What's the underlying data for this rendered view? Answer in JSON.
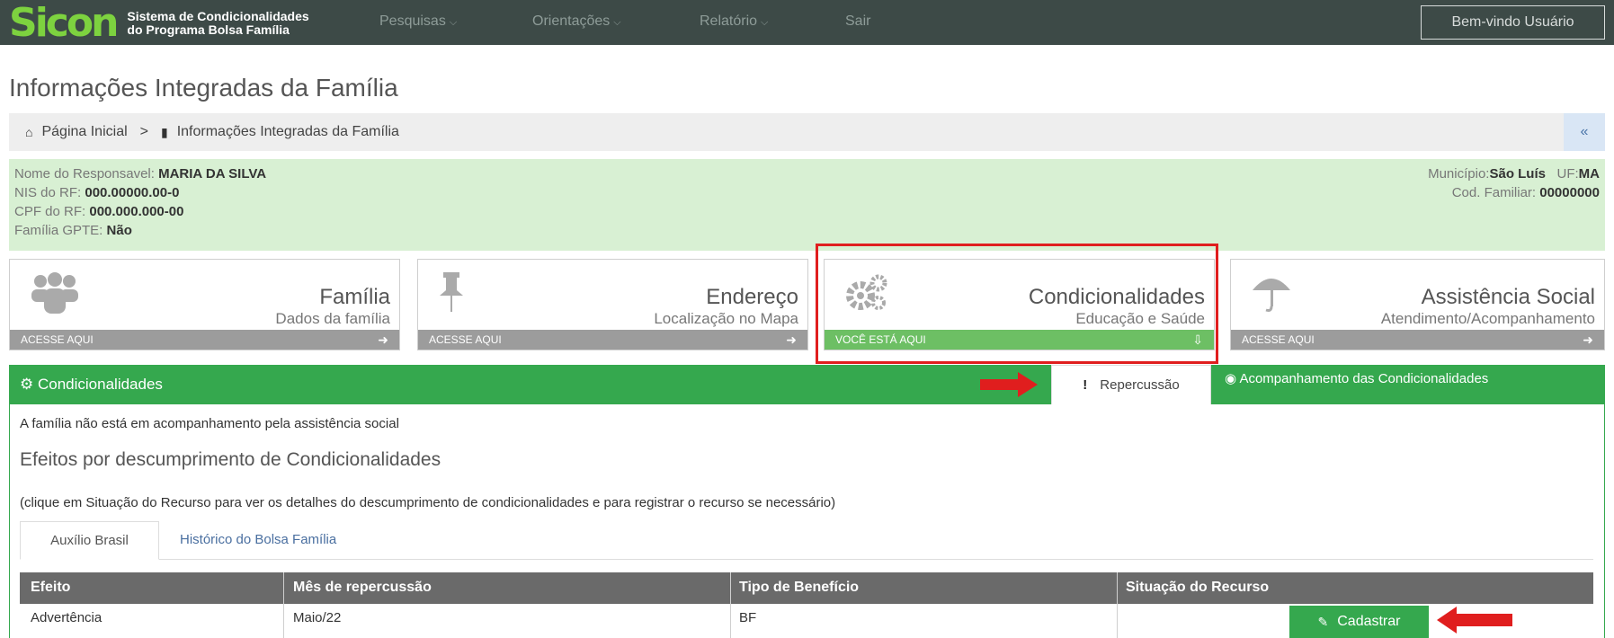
{
  "navbar": {
    "logo": "Sicon",
    "logo_sub_1": "Sistema de Condicionalidades",
    "logo_sub_2": "do Programa Bolsa Família",
    "menu": [
      {
        "label": "Pesquisas",
        "icon": "chevron-down-icon"
      },
      {
        "label": "Orientações",
        "icon": "chevron-down-icon"
      },
      {
        "label": "Relatório",
        "icon": "chevron-down-icon"
      },
      {
        "label": "Sair"
      }
    ],
    "welcome": "Bem-vindo Usuário"
  },
  "page_title": "Informações Integradas da Família",
  "breadcrumb": {
    "home": "Página Inicial",
    "separator": ">",
    "current": "Informações Integradas da Família",
    "collapse": "«"
  },
  "family": {
    "responsavel_label": "Nome do Responsavel:",
    "responsavel": "MARIA DA SILVA",
    "nis_label": "NIS do RF:",
    "nis": "000.00000.00-0",
    "cpf_label": "CPF do RF:",
    "cpf": "000.000.000-00",
    "gpte_label": "Família GPTE:",
    "gpte": "Não",
    "municipio_label": "Município:",
    "municipio": "São Luís",
    "uf_label": "UF:",
    "uf": "MA",
    "cod_label": "Cod. Familiar:",
    "cod": "00000000"
  },
  "cards": [
    {
      "title": "Família",
      "sub": "Dados da família",
      "footer": "ACESSE AQUI",
      "icon": "users-icon"
    },
    {
      "title": "Endereço",
      "sub": "Localização no Mapa",
      "footer": "ACESSE AQUI",
      "icon": "pin-icon"
    },
    {
      "title": "Condicionalidades",
      "sub": "Educação e Saúde",
      "footer": "VOCÊ ESTÁ AQUI",
      "icon": "gears-icon",
      "active": true
    },
    {
      "title": "Assistência Social",
      "sub": "Atendimento/Acompanhamento",
      "footer": "ACESSE AQUI",
      "icon": "umbrella-icon"
    }
  ],
  "panel": {
    "title": "Condicionalidades",
    "tabs": [
      {
        "label": "Repercussão",
        "active": true
      },
      {
        "label": "Acompanhamento das Condicionalidades"
      }
    ],
    "message": "A família não está em acompanhamento pela assistência social",
    "subtitle": "Efeitos por descumprimento de Condicionalidades",
    "hint": "(clique em Situação do Recurso para ver os detalhes do descumprimento de condicionalidades e para registrar o recurso se necessário)",
    "subtabs": [
      {
        "label": "Auxílio Brasil",
        "active": true
      },
      {
        "label": "Histórico do Bolsa Família"
      }
    ]
  },
  "table": {
    "headers": [
      "Efeito",
      "Mês de repercussão",
      "Tipo de Benefício",
      "Situação do Recurso"
    ],
    "rows": [
      {
        "efeito": "Advertência",
        "mes": "Maio/22",
        "tipo": "BF",
        "action": "Cadastrar"
      }
    ]
  },
  "colors": {
    "navbar": "#3d4a47",
    "logo": "#7dd23f",
    "green": "#35a84e",
    "info_bg": "#d8f0d3",
    "highlight": "#e01e1e"
  }
}
